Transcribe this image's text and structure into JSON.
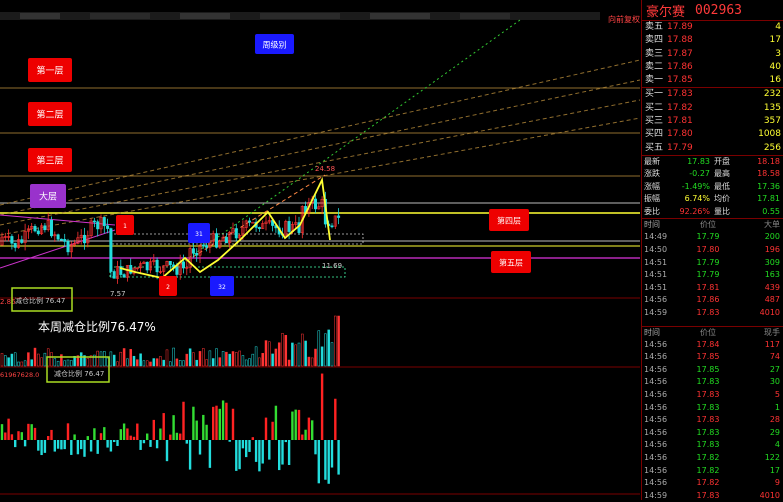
{
  "header": {
    "review_button": "向前复权"
  },
  "stock": {
    "name": "豪尔赛",
    "code": "002963"
  },
  "layer_labels": {
    "weekly": "周级别",
    "layer1": "第一层",
    "layer2": "第二层",
    "layer3": "第三层",
    "big_layer": "大层",
    "layer4": "第四层",
    "layer5": "第五层"
  },
  "price_annotations": {
    "high": "24.58",
    "low": "7.57",
    "right_low": "11.69",
    "left_value": "2.86"
  },
  "wave_markers": {
    "m1": "1",
    "m2": "2",
    "m3": "31",
    "m4": "32"
  },
  "volume_box": {
    "label": "减仓比例",
    "value": "76.47",
    "caption": "本周减仓比例76.47%"
  },
  "indicator": {
    "axis_value": "61967628.0",
    "box_label": "减仓比例",
    "box_value": "76.47"
  },
  "order_book": {
    "asks": [
      {
        "label": "卖五",
        "price": "17.89",
        "vol": "4"
      },
      {
        "label": "卖四",
        "price": "17.88",
        "vol": "17"
      },
      {
        "label": "卖三",
        "price": "17.87",
        "vol": "3"
      },
      {
        "label": "卖二",
        "price": "17.86",
        "vol": "40"
      },
      {
        "label": "卖一",
        "price": "17.85",
        "vol": "16"
      }
    ],
    "bids": [
      {
        "label": "买一",
        "price": "17.83",
        "vol": "232"
      },
      {
        "label": "买二",
        "price": "17.82",
        "vol": "135"
      },
      {
        "label": "买三",
        "price": "17.81",
        "vol": "357"
      },
      {
        "label": "买四",
        "price": "17.80",
        "vol": "1008"
      },
      {
        "label": "买五",
        "price": "17.79",
        "vol": "256"
      }
    ]
  },
  "quote": [
    {
      "k1": "最新",
      "v1": "17.83",
      "c1": "g",
      "k2": "开盘",
      "v2": "18.18",
      "c2": "r"
    },
    {
      "k1": "涨跌",
      "v1": "-0.27",
      "c1": "g",
      "k2": "最高",
      "v2": "18.58",
      "c2": "r"
    },
    {
      "k1": "涨幅",
      "v1": "-1.49%",
      "c1": "g",
      "k2": "最低",
      "v2": "17.36",
      "c2": "g"
    },
    {
      "k1": "振幅",
      "v1": "6.74%",
      "c1": "y",
      "k2": "均价",
      "v2": "17.81",
      "c2": "g"
    },
    {
      "k1": "委比",
      "v1": "92.26%",
      "c1": "r",
      "k2": "量比",
      "v2": "0.55",
      "c2": "g"
    }
  ],
  "trades_header": {
    "time": "时间",
    "price": "价位",
    "vol1": "大单",
    "vol2": "现手"
  },
  "trades1": [
    {
      "t": "14:49",
      "p": "17.79",
      "v": "200",
      "c": "g"
    },
    {
      "t": "14:50",
      "p": "17.80",
      "v": "196",
      "c": "r"
    },
    {
      "t": "14:51",
      "p": "17.79",
      "v": "309",
      "c": "g"
    },
    {
      "t": "14:51",
      "p": "17.79",
      "v": "163",
      "c": "g"
    },
    {
      "t": "14:51",
      "p": "17.81",
      "v": "439",
      "c": "r"
    },
    {
      "t": "14:56",
      "p": "17.86",
      "v": "487",
      "c": "r"
    },
    {
      "t": "14:59",
      "p": "17.83",
      "v": "4010",
      "c": "r"
    }
  ],
  "trades2": [
    {
      "t": "14:56",
      "p": "17.84",
      "v": "117",
      "c": "r"
    },
    {
      "t": "14:56",
      "p": "17.85",
      "v": "74",
      "c": "r"
    },
    {
      "t": "14:56",
      "p": "17.85",
      "v": "27",
      "c": "g"
    },
    {
      "t": "14:56",
      "p": "17.83",
      "v": "30",
      "c": "g"
    },
    {
      "t": "14:56",
      "p": "17.83",
      "v": "5",
      "c": "r"
    },
    {
      "t": "14:56",
      "p": "17.83",
      "v": "1",
      "c": "g"
    },
    {
      "t": "14:56",
      "p": "17.83",
      "v": "28",
      "c": "r"
    },
    {
      "t": "14:56",
      "p": "17.83",
      "v": "29",
      "c": "g"
    },
    {
      "t": "14:56",
      "p": "17.83",
      "v": "4",
      "c": "g"
    },
    {
      "t": "14:56",
      "p": "17.82",
      "v": "122",
      "c": "g"
    },
    {
      "t": "14:56",
      "p": "17.82",
      "v": "17",
      "c": "g"
    },
    {
      "t": "14:56",
      "p": "17.82",
      "v": "9",
      "c": "r"
    },
    {
      "t": "14:59",
      "p": "17.83",
      "v": "4010",
      "c": "r"
    }
  ]
}
